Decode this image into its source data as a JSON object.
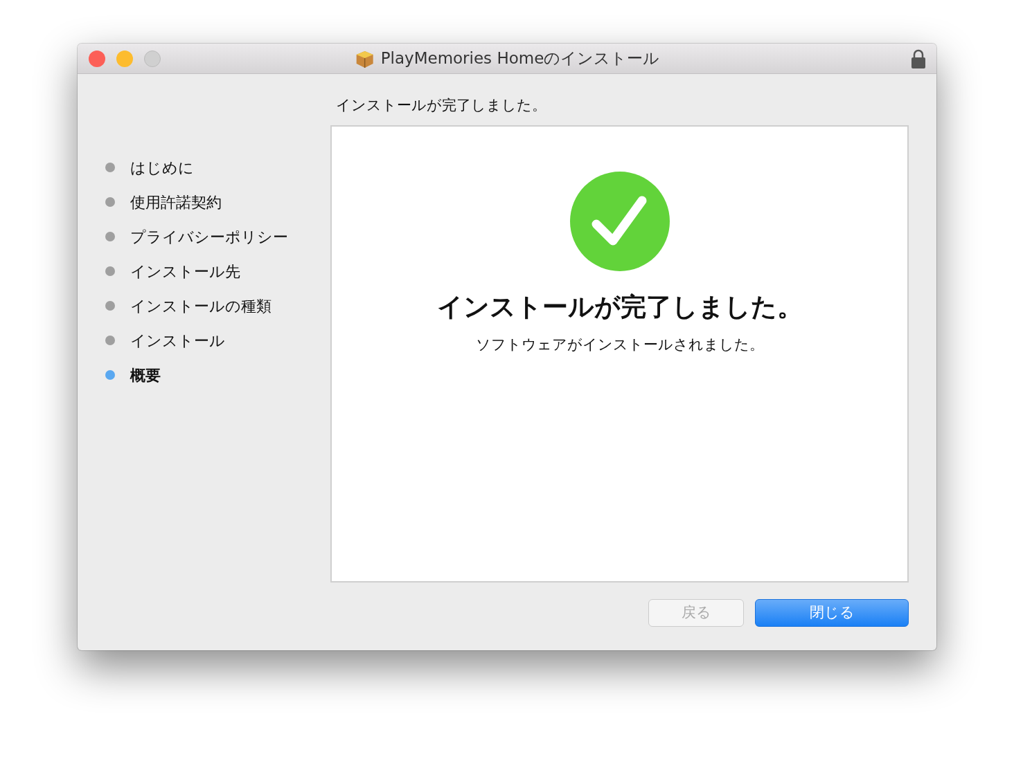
{
  "window": {
    "title": "PlayMemories Homeのインストール",
    "zoom_disabled": true
  },
  "steps": [
    {
      "label": "はじめに",
      "selected": false
    },
    {
      "label": "使用許諾契約",
      "selected": false
    },
    {
      "label": "プライバシーポリシー",
      "selected": false
    },
    {
      "label": "インストール先",
      "selected": false
    },
    {
      "label": "インストールの種類",
      "selected": false
    },
    {
      "label": "インストール",
      "selected": false
    },
    {
      "label": "概要",
      "selected": true
    }
  ],
  "heading": "インストールが完了しました。",
  "panel": {
    "title": "インストールが完了しました。",
    "message": "ソフトウェアがインストールされました。"
  },
  "buttons": [
    {
      "label": "戻る",
      "disabled": true,
      "default": false
    },
    {
      "label": "閉じる",
      "disabled": false,
      "default": true
    }
  ]
}
